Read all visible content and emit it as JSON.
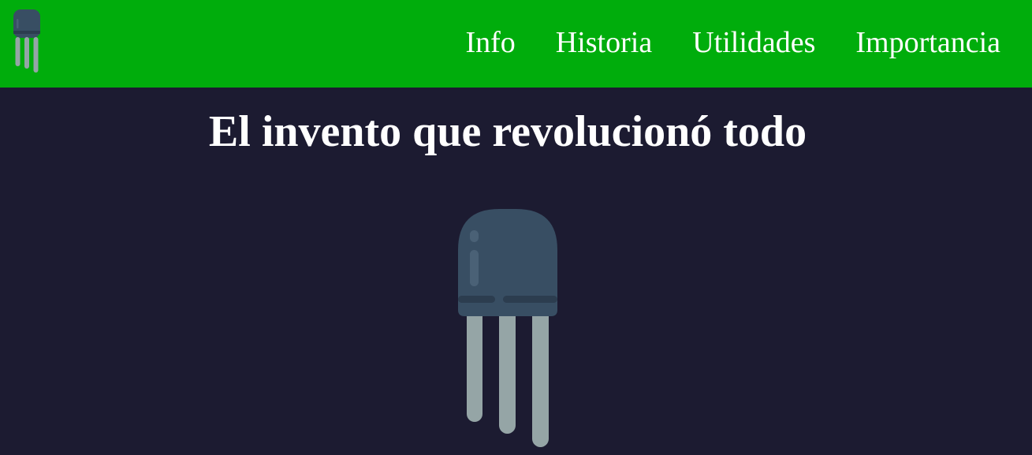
{
  "header": {
    "logo_icon": "transistor-icon",
    "background_color": "#00ad0c",
    "nav": [
      {
        "label": "Info"
      },
      {
        "label": "Historia"
      },
      {
        "label": "Utilidades"
      },
      {
        "label": "Importancia"
      }
    ]
  },
  "main": {
    "title": "El invento que revolucionó todo",
    "hero_icon": "transistor-icon",
    "background_color": "#1c1b31"
  },
  "colors": {
    "transistor_body": "#384e63",
    "transistor_band": "#2c3d4f",
    "transistor_highlight": "#4a6176",
    "transistor_legs": "#95a5a6"
  }
}
